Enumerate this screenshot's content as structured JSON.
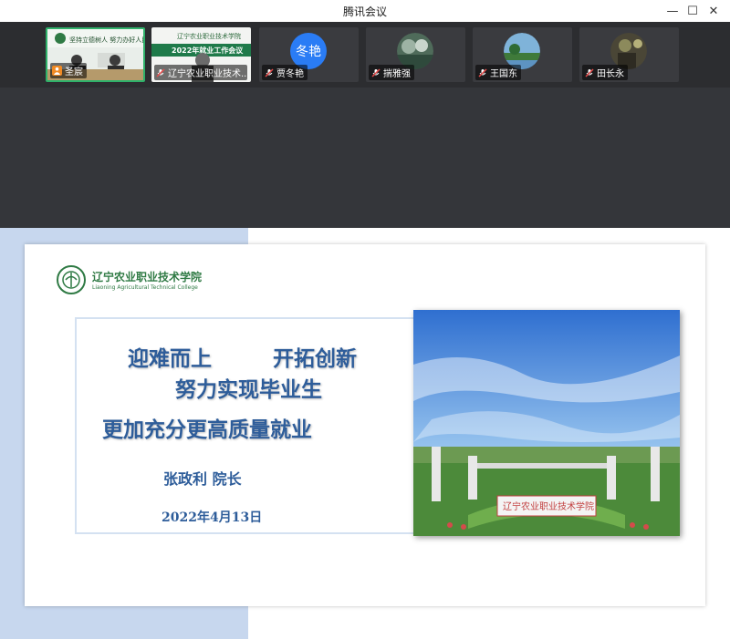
{
  "window": {
    "title": "腾讯会议",
    "controls": {
      "minimize": "—",
      "maximize": "☐",
      "close": "✕"
    }
  },
  "participants": [
    {
      "name": "圣宸",
      "icon": "person-icon",
      "muted": false,
      "active": true,
      "banner": "坚持立德树人 努力办好人民满意的大学"
    },
    {
      "name": "辽宁农业职业技术...",
      "icon": "mic-off-icon",
      "muted": true,
      "active": false,
      "banner_top": "辽宁农业职业技术学院",
      "banner_mid": "2022年就业工作会议"
    },
    {
      "name": "贾冬艳",
      "icon": "mic-off-icon",
      "muted": true,
      "active": false,
      "avatar_text": "冬艳",
      "avatar_color": "#2a7cf5"
    },
    {
      "name": "揣雅强",
      "icon": "mic-off-icon",
      "muted": true,
      "active": false
    },
    {
      "name": "王国东",
      "icon": "mic-off-icon",
      "muted": true,
      "active": false
    },
    {
      "name": "田长永",
      "icon": "mic-off-icon",
      "muted": true,
      "active": false
    }
  ],
  "slide": {
    "logo_cn": "辽宁农业职业技术学院",
    "logo_en": "Liaoning Agricultural Technical College",
    "headline_line1_a": "迎难而上",
    "headline_line1_b": "开拓创新",
    "headline_line2": "努力实现毕业生",
    "headline_line3": "更加充分更高质量就业",
    "presenter": "张政利 院长",
    "date": "2022年4月13日",
    "photo_gate_text": "辽宁农业职业技术学院"
  },
  "colors": {
    "active_border": "#2fb16a",
    "slide_text": "#2e5d9a",
    "strip_bg": "#2c2d30",
    "share_stripe": "#c7d7ee"
  }
}
